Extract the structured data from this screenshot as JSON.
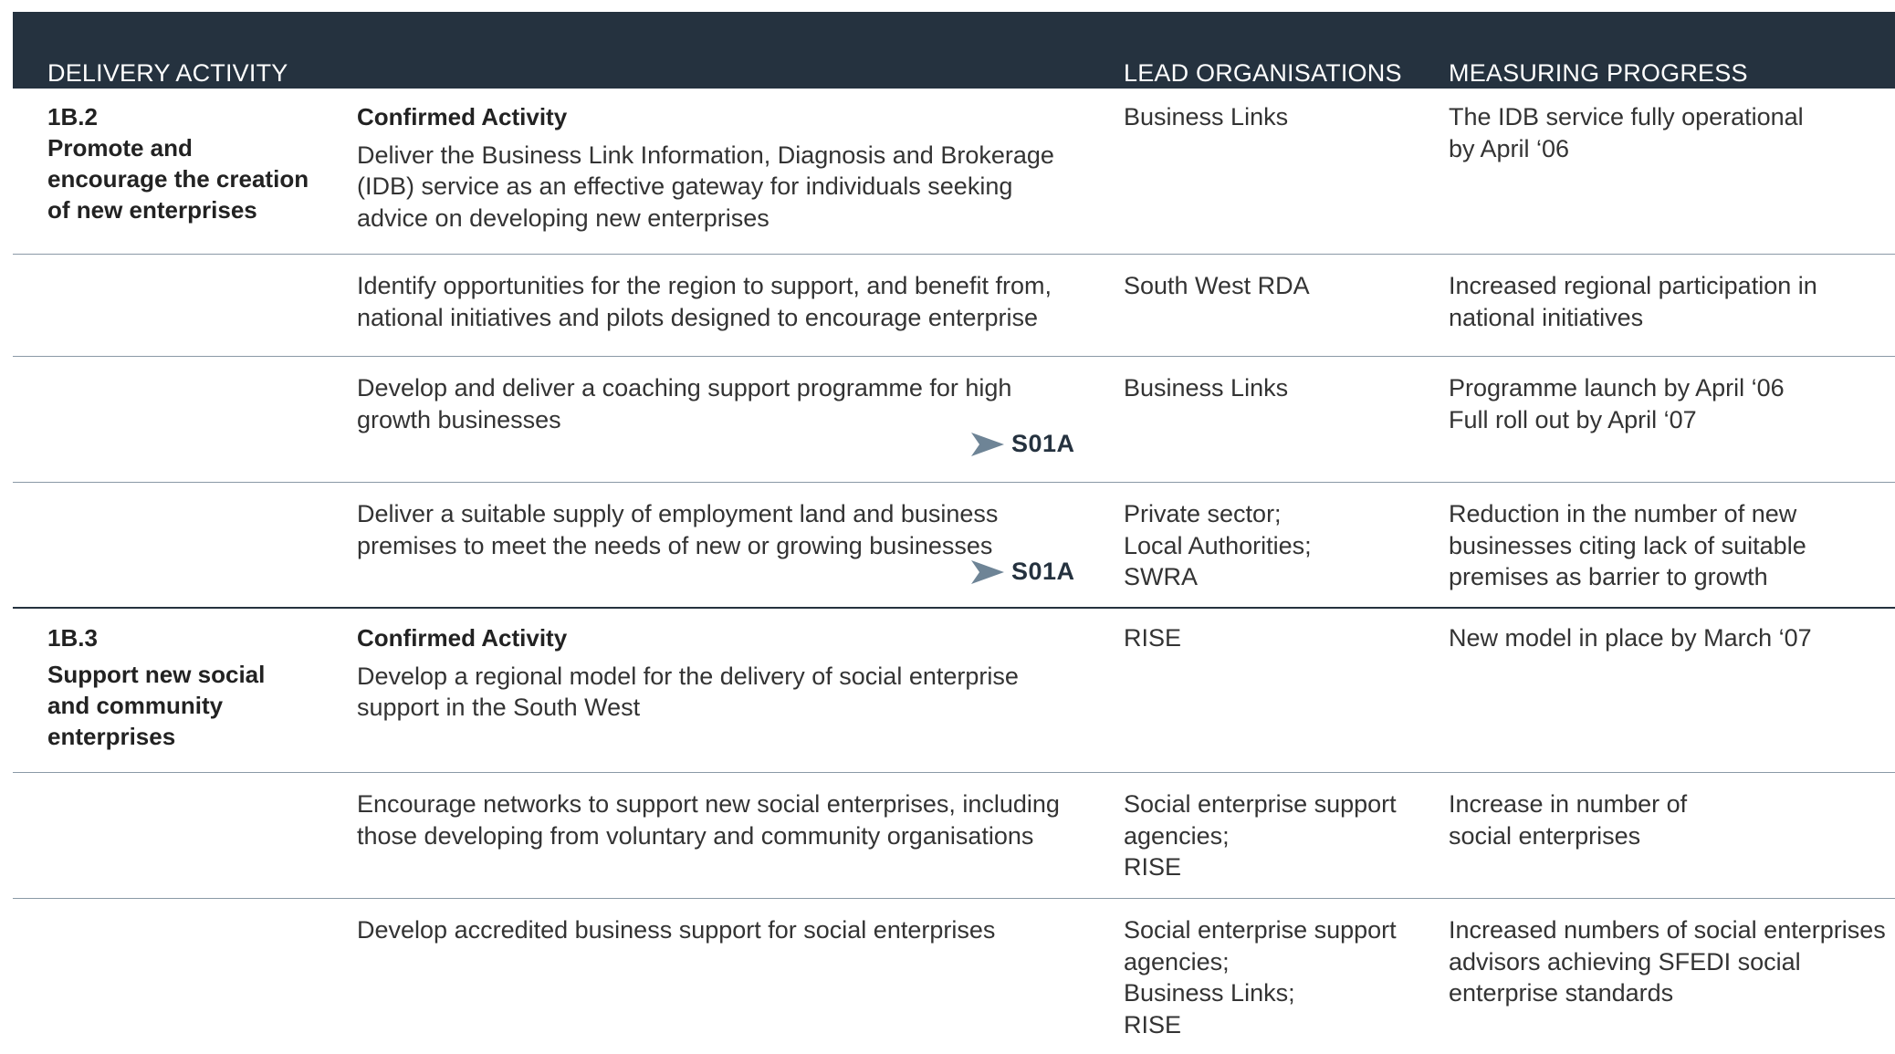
{
  "header": {
    "delivery_activity": "DELIVERY ACTIVITY",
    "lead_organisations": "LEAD ORGANISATIONS",
    "measuring_progress": "MEASURING PROGRESS"
  },
  "rows": [
    {
      "code": "1B.2",
      "code_title_lines": [
        "Promote and",
        "encourage the creation",
        "of new enterprises"
      ],
      "confirmed_label": "Confirmed Activity",
      "activity_lines": [
        "Deliver the Business Link Information, Diagnosis and Brokerage",
        "(IDB) service as an effective gateway for individuals seeking",
        "advice on developing new enterprises"
      ],
      "lead_lines": [
        "Business Links"
      ],
      "measure_lines": [
        "The IDB service fully operational",
        "by April ‘06"
      ]
    },
    {
      "activity_lines": [
        "Identify opportunities for the region to support, and benefit from,",
        "national initiatives and pilots designed to encourage enterprise"
      ],
      "lead_lines": [
        "South West RDA"
      ],
      "measure_lines": [
        "Increased regional participation in",
        "national initiatives"
      ]
    },
    {
      "activity_lines": [
        "Develop and deliver a coaching support programme for high",
        "growth businesses"
      ],
      "tag": "S01A",
      "lead_lines": [
        "Business Links"
      ],
      "measure_lines": [
        "Programme launch by April ‘06",
        "Full roll out by April ‘07"
      ]
    },
    {
      "activity_lines": [
        "Deliver a suitable supply of employment land and business",
        "premises to meet the needs of new or growing businesses"
      ],
      "tag": "S01A",
      "lead_lines": [
        "Private sector;",
        "Local Authorities;",
        "SWRA"
      ],
      "measure_lines": [
        "Reduction in the number of new",
        "businesses citing lack of suitable",
        "premises as barrier to growth"
      ]
    },
    {
      "code": "1B.3",
      "code_title_lines": [
        "Support new social",
        "and community",
        "enterprises"
      ],
      "confirmed_label": "Confirmed Activity",
      "activity_lines": [
        "Develop a regional model for the delivery of social enterprise",
        "support in the South West"
      ],
      "lead_lines": [
        "RISE"
      ],
      "measure_lines": [
        "New model in place by March ‘07"
      ]
    },
    {
      "activity_lines": [
        "Encourage networks to support new social enterprises, including",
        "those developing from voluntary and community organisations"
      ],
      "lead_lines": [
        "Social enterprise support",
        "agencies;",
        "RISE"
      ],
      "measure_lines": [
        "Increase in number of",
        "social enterprises"
      ]
    },
    {
      "activity_lines": [
        "Develop accredited business support for social enterprises"
      ],
      "lead_lines": [
        "Social enterprise support",
        "agencies;",
        "Business Links;",
        "RISE"
      ],
      "measure_lines": [
        "Increased numbers of social enterprises",
        "advisors achieving SFEDI social",
        "enterprise standards"
      ]
    }
  ],
  "colors": {
    "header_bg": "#25323f",
    "header_text": "#ffffff",
    "rule": "#8a99a6",
    "arrow": "#6e8496"
  }
}
